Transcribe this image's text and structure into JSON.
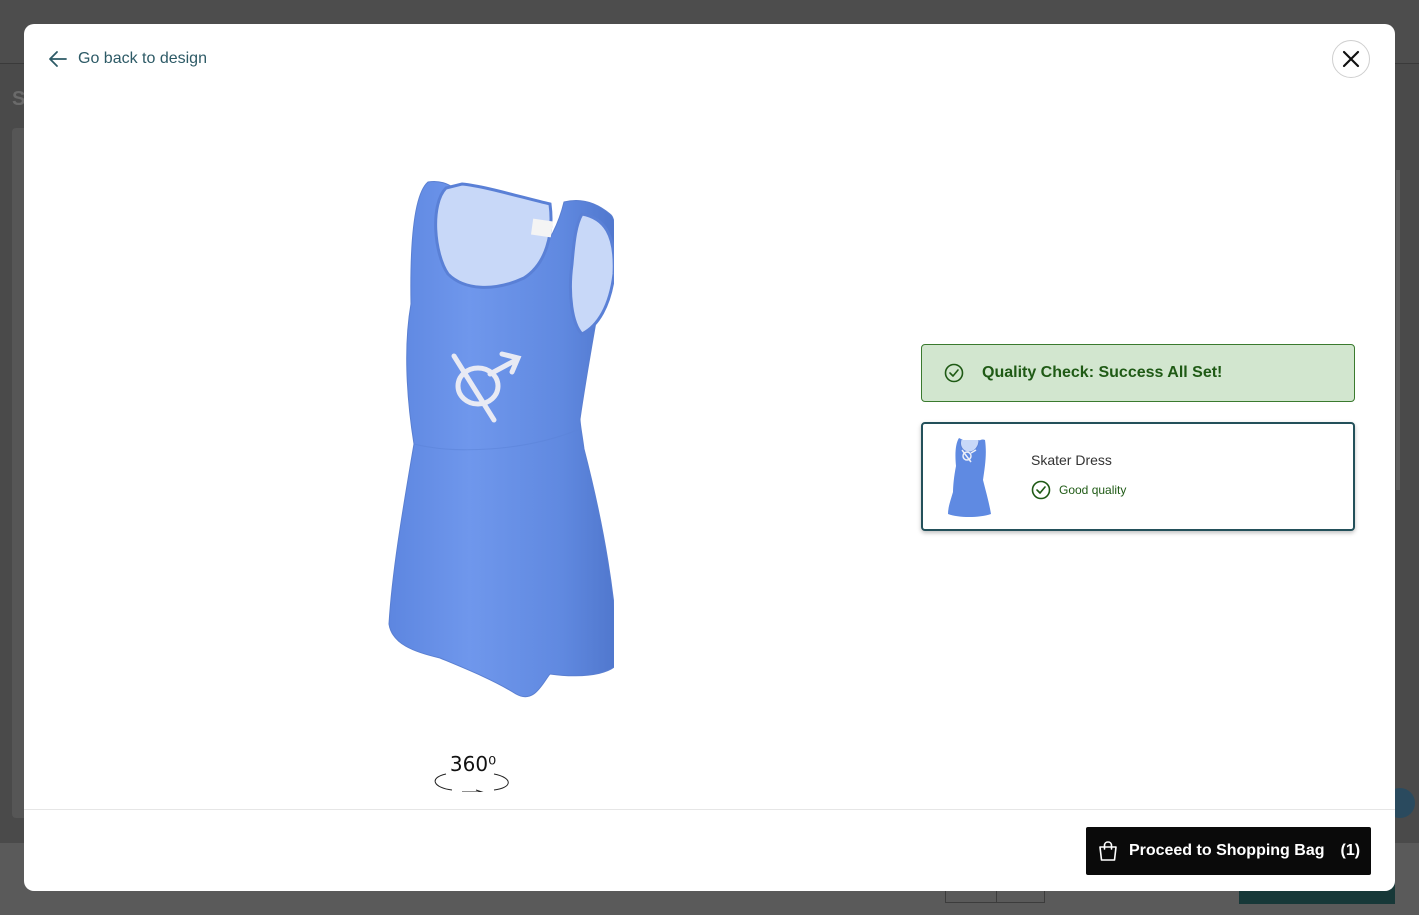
{
  "modal": {
    "back_label": "Go back to design",
    "close_icon": "close-icon"
  },
  "viewer": {
    "rotate_label": "360⁰",
    "garment_color": "#6b93e6",
    "logo_symbol": "⚨"
  },
  "quality_check": {
    "message": "Quality Check: Success All Set!",
    "bg_color": "#d2e6cf",
    "accent_color": "#1f5a15"
  },
  "product": {
    "name": "Skater Dress",
    "quality_label": "Good quality"
  },
  "footer": {
    "proceed_label": "Proceed to Shopping Bag",
    "bag_count": "(1)"
  }
}
